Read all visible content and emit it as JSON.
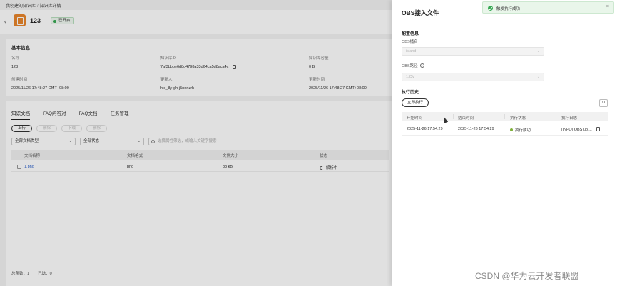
{
  "breadcrumb": {
    "parent": "我创建的知识库",
    "separator": "/",
    "current": "知识库详情"
  },
  "knowledge_base": {
    "title": "123",
    "status": "已开启"
  },
  "basic_info": {
    "title": "基本信息",
    "fields": [
      {
        "label": "名称",
        "value": "123"
      },
      {
        "label": "知识库ID",
        "value": "7af3bbbe6d8d4798a33d64ca5d8aca4c"
      },
      {
        "label": "知识库容量",
        "value": "0 B"
      },
      {
        "label": "创建时间",
        "value": "2025/11/26 17:48:27 GMT+08:00"
      },
      {
        "label": "更新人",
        "value": "hid_8y-gh-j5nnnzrh"
      },
      {
        "label": "更新时间",
        "value": "2025/11/26 17:48:27 GMT+08:00"
      }
    ]
  },
  "tabs": [
    "知识文档",
    "FAQ问答对",
    "FAQ文档",
    "任务管理"
  ],
  "toolbar": {
    "upload": "上传",
    "delete_label": "删除",
    "download": "下载",
    "remove": "删除"
  },
  "filters": {
    "type": "全部文档类型",
    "status": "全部状态",
    "search_placeholder": "选择属性筛选，或输入关键字搜索"
  },
  "doc_table": {
    "headers": [
      "文档名称",
      "文档格式",
      "文件大小",
      "状态"
    ],
    "rows": [
      {
        "name": "1.png",
        "format": "png",
        "size": "88 kB",
        "status": "解析中"
      }
    ]
  },
  "footer": {
    "total": "总条数：1",
    "selected": "已选：0"
  },
  "drawer": {
    "title": "OBS接入文件",
    "config_title": "配置信息",
    "bucket_label": "OBS桶名",
    "bucket_value": "island",
    "path_label": "OBS路径",
    "path_value": "1.CV",
    "history_title": "执行历史",
    "run_now": "立即执行",
    "history_headers": [
      "开始时间",
      "结束时间",
      "执行状态",
      "执行日志"
    ],
    "history_rows": [
      {
        "start": "2025-11-26 17:54:29",
        "end": "2025-11-26 17:54:29",
        "status": "执行成功",
        "log": "[INFO] OBS upl..."
      }
    ]
  },
  "toast": {
    "message": "触发执行成功"
  },
  "watermark": "CSDN @华为云开发者联盟",
  "colors": {
    "success": "#36a852",
    "accent_orange": "#e9862c",
    "link": "#3366cc"
  }
}
